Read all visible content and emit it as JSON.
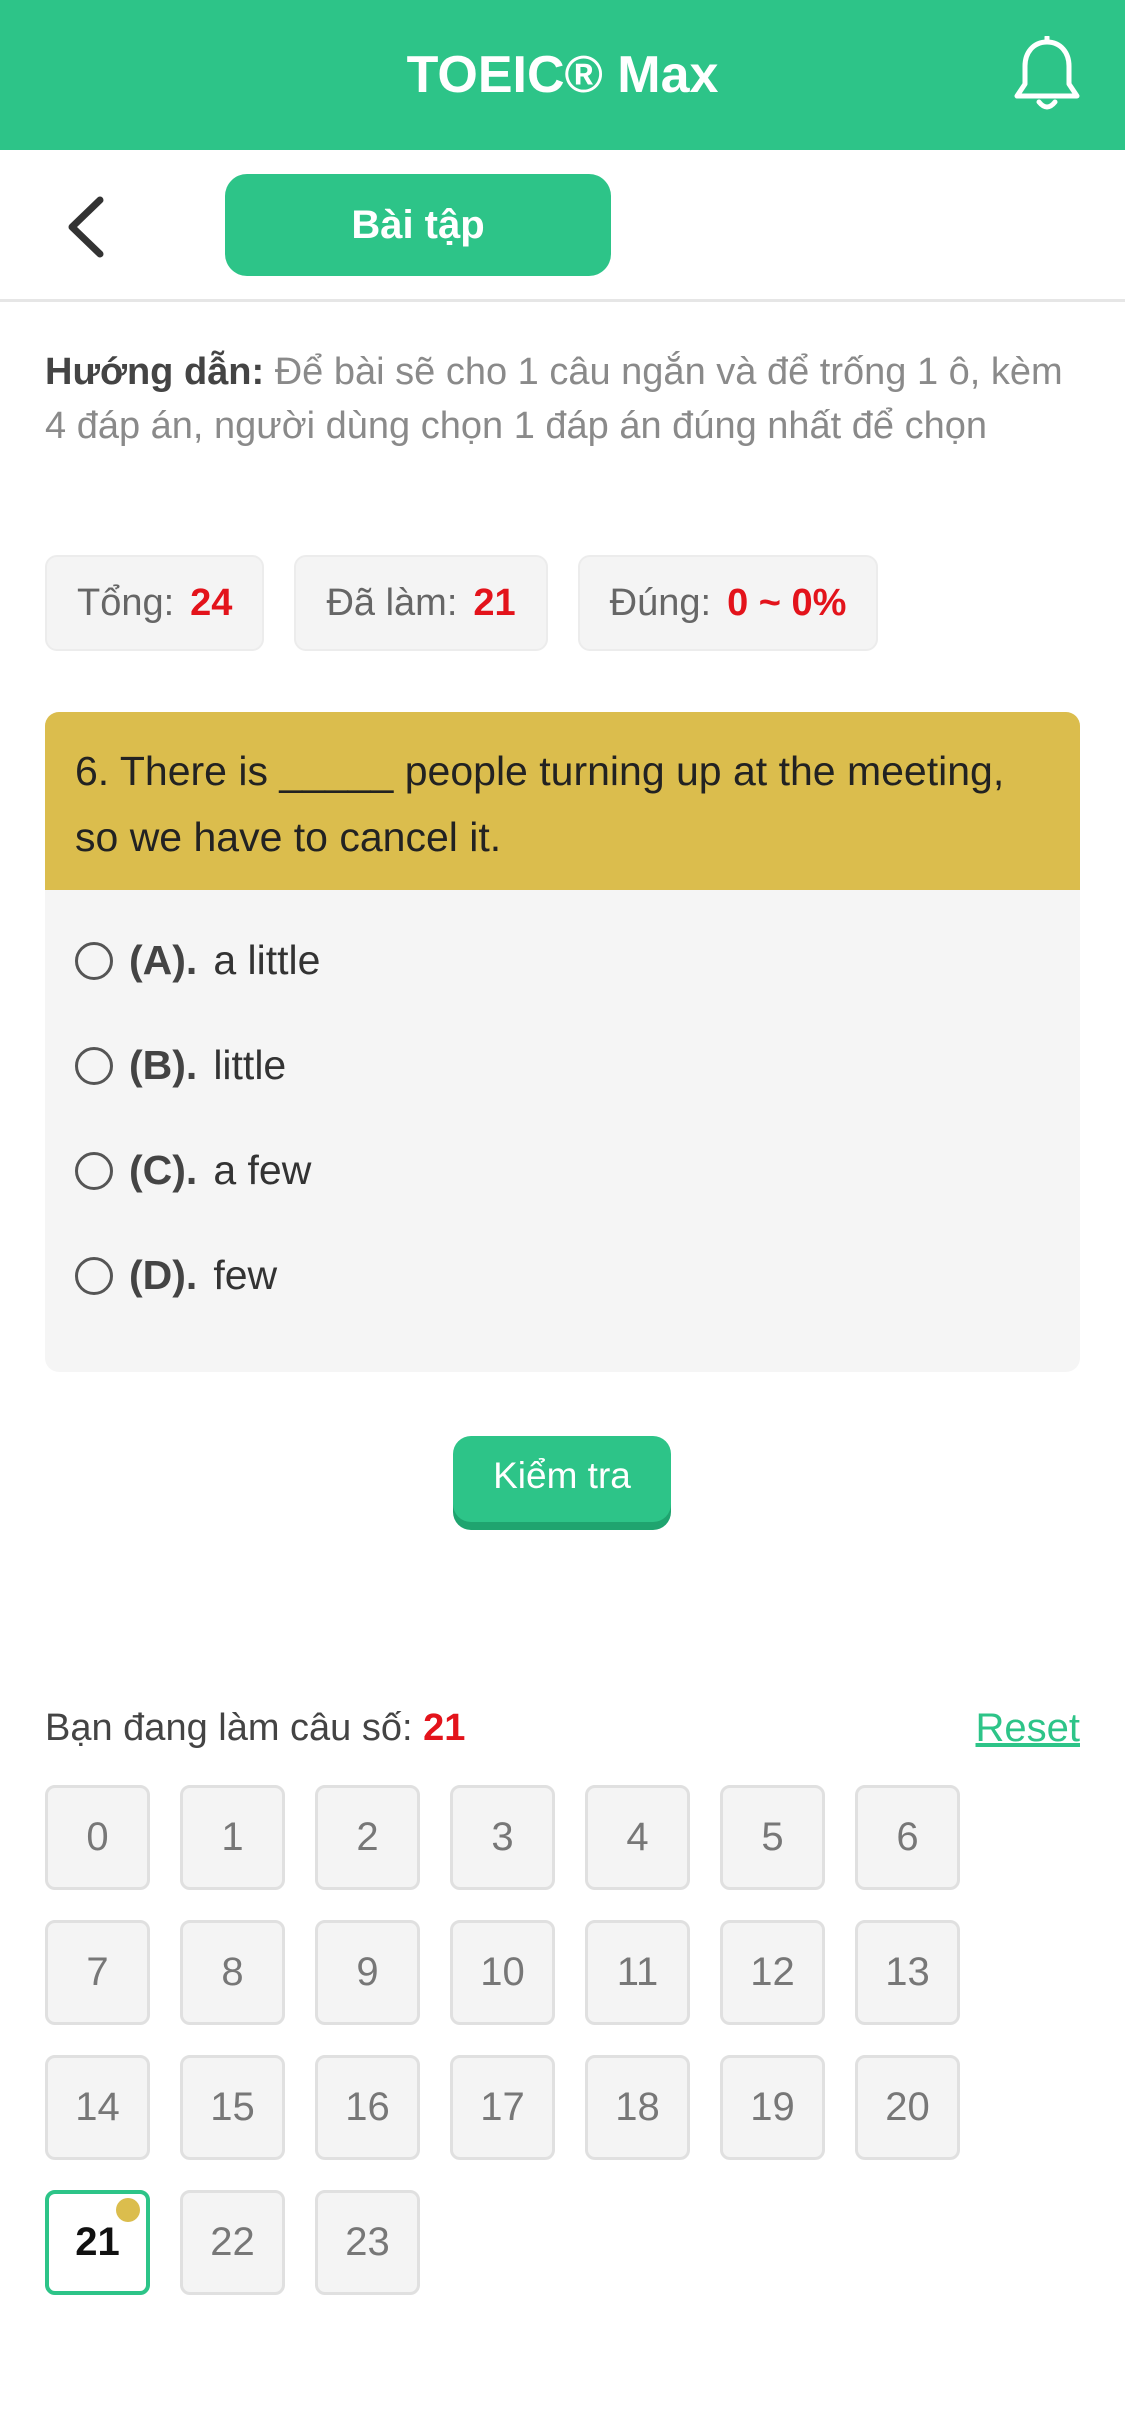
{
  "header": {
    "title": "TOEIC® Max",
    "bell_icon": "bell-icon"
  },
  "subbar": {
    "back_icon": "chevron-left-icon",
    "tab_label": "Bài tập"
  },
  "guide": {
    "label": "Hướng dẫn:",
    "text": " Để bài sẽ cho 1 câu ngắn và để trống 1 ô, kèm 4 đáp án, người dùng chọn 1 đáp án đúng nhất để chọn"
  },
  "stats": {
    "total_label": "Tổng:",
    "total_value": "24",
    "done_label": "Đã làm:",
    "done_value": "21",
    "correct_label": "Đúng:",
    "correct_value": "0 ~ 0%"
  },
  "question": {
    "text": "6. There is _____ people turning up at the meeting, so we have to cancel it.",
    "options": [
      {
        "label": "(A).",
        "text": "a little"
      },
      {
        "label": "(B).",
        "text": "little"
      },
      {
        "label": "(C).",
        "text": "a few"
      },
      {
        "label": "(D).",
        "text": "few"
      }
    ]
  },
  "check_button": "Kiểm tra",
  "progress": {
    "label": "Bạn đang làm câu số:",
    "current": "21",
    "reset": "Reset"
  },
  "grid": [
    "0",
    "1",
    "2",
    "3",
    "4",
    "5",
    "6",
    "7",
    "8",
    "9",
    "10",
    "11",
    "12",
    "13",
    "14",
    "15",
    "16",
    "17",
    "18",
    "19",
    "20",
    "21",
    "22",
    "23"
  ],
  "colors": {
    "brand": "#2dc488",
    "question_bg": "#dbbd4d",
    "highlight": "#e3131b"
  }
}
